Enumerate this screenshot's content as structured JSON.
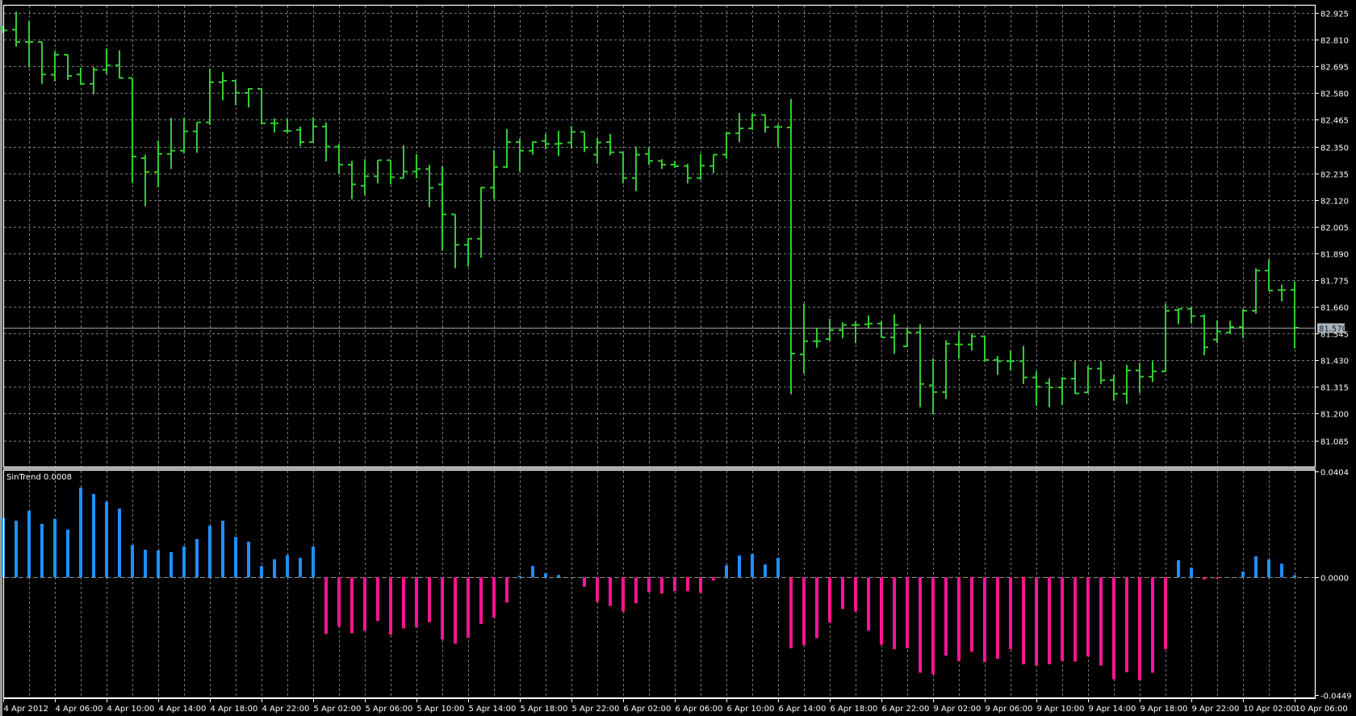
{
  "colors": {
    "background": "#000000",
    "bars": "#33cc33",
    "hist_up": "#1e90ff",
    "hist_down": "#ff1493",
    "grid": "#7a7a7a",
    "axis": "#ffffff",
    "price_line": "#a0a0a0",
    "price_label_bg": "#a9b4bd"
  },
  "chart_data": [
    {
      "type": "ohlc",
      "title": "",
      "ylim": [
        81.085,
        82.925
      ],
      "y_ticks": [
        "82.925",
        "82.810",
        "82.695",
        "82.580",
        "82.465",
        "82.350",
        "82.235",
        "82.120",
        "82.005",
        "81.890",
        "81.775",
        "81.660",
        "81.545",
        "81.430",
        "81.315",
        "81.200",
        "81.085"
      ],
      "current_price": "81.570",
      "grid": true,
      "bar_interval": "1 hour",
      "ohlc": [
        [
          82.86,
          82.87,
          82.84,
          82.85
        ],
        [
          82.853,
          82.93,
          82.78,
          82.8
        ],
        [
          82.8,
          82.89,
          82.69,
          82.8
        ],
        [
          82.8,
          82.8,
          82.62,
          82.66
        ],
        [
          82.659,
          82.76,
          82.63,
          82.745
        ],
        [
          82.745,
          82.745,
          82.636,
          82.654
        ],
        [
          82.66,
          82.69,
          82.616,
          82.62
        ],
        [
          82.62,
          82.693,
          82.575,
          82.68
        ],
        [
          82.68,
          82.772,
          82.662,
          82.7
        ],
        [
          82.7,
          82.764,
          82.643,
          82.645
        ],
        [
          82.645,
          82.645,
          82.193,
          82.307
        ],
        [
          82.3,
          82.315,
          82.092,
          82.24
        ],
        [
          82.24,
          82.376,
          82.174,
          82.318
        ],
        [
          82.318,
          82.473,
          82.253,
          82.332
        ],
        [
          82.332,
          82.473,
          82.32,
          82.415
        ],
        [
          82.415,
          82.454,
          82.323,
          82.454
        ],
        [
          82.454,
          82.685,
          82.442,
          82.627
        ],
        [
          82.627,
          82.67,
          82.549,
          82.633
        ],
        [
          82.633,
          82.633,
          82.527,
          82.581
        ],
        [
          82.581,
          82.602,
          82.518,
          82.598
        ],
        [
          82.598,
          82.598,
          82.445,
          82.45
        ],
        [
          82.45,
          82.471,
          82.41,
          82.45
        ],
        [
          82.417,
          82.469,
          82.407,
          82.417
        ],
        [
          82.422,
          82.436,
          82.352,
          82.369
        ],
        [
          82.369,
          82.474,
          82.367,
          82.436
        ],
        [
          82.436,
          82.454,
          82.286,
          82.35
        ],
        [
          82.349,
          82.361,
          82.233,
          82.272
        ],
        [
          82.272,
          82.288,
          82.123,
          82.187
        ],
        [
          82.181,
          82.295,
          82.141,
          82.222
        ],
        [
          82.222,
          82.291,
          82.191,
          82.291
        ],
        [
          82.291,
          82.291,
          82.187,
          82.218
        ],
        [
          82.214,
          82.355,
          82.214,
          82.242
        ],
        [
          82.242,
          82.317,
          82.213,
          82.253
        ],
        [
          82.253,
          82.271,
          82.089,
          82.172
        ],
        [
          82.187,
          82.265,
          81.901,
          82.058
        ],
        [
          82.058,
          82.058,
          81.826,
          81.927
        ],
        [
          81.927,
          81.956,
          81.834,
          81.953
        ],
        [
          81.953,
          82.176,
          81.871,
          82.173
        ],
        [
          82.173,
          82.334,
          82.123,
          82.262
        ],
        [
          82.262,
          82.425,
          82.257,
          82.369
        ],
        [
          82.369,
          82.384,
          82.242,
          82.332
        ],
        [
          82.332,
          82.371,
          82.315,
          82.369
        ],
        [
          82.374,
          82.404,
          82.338,
          82.361
        ],
        [
          82.361,
          82.418,
          82.309,
          82.363
        ],
        [
          82.367,
          82.438,
          82.341,
          82.413
        ],
        [
          82.413,
          82.413,
          82.326,
          82.346
        ],
        [
          82.315,
          82.386,
          82.276,
          82.367
        ],
        [
          82.369,
          82.404,
          82.312,
          82.325
        ],
        [
          82.325,
          82.325,
          82.191,
          82.214
        ],
        [
          82.214,
          82.35,
          82.158,
          82.315
        ],
        [
          82.318,
          82.344,
          82.271,
          82.288
        ],
        [
          82.288,
          82.295,
          82.253,
          82.272
        ],
        [
          82.272,
          82.288,
          82.257,
          82.265
        ],
        [
          82.266,
          82.276,
          82.191,
          82.214
        ],
        [
          82.214,
          82.317,
          82.207,
          82.268
        ],
        [
          82.266,
          82.315,
          82.236,
          82.315
        ],
        [
          82.315,
          82.413,
          82.297,
          82.407
        ],
        [
          82.407,
          82.494,
          82.369,
          82.428
        ],
        [
          82.428,
          82.492,
          82.421,
          82.485
        ],
        [
          82.486,
          82.486,
          82.41,
          82.433
        ],
        [
          82.434,
          82.445,
          82.346,
          82.434
        ],
        [
          82.432,
          82.555,
          81.284,
          81.459
        ],
        [
          81.455,
          81.674,
          81.373,
          81.512
        ],
        [
          81.512,
          81.57,
          81.484,
          81.512
        ],
        [
          81.521,
          81.608,
          81.512,
          81.56
        ],
        [
          81.56,
          81.593,
          81.524,
          81.582
        ],
        [
          81.582,
          81.597,
          81.504,
          81.582
        ],
        [
          81.585,
          81.623,
          81.565,
          81.588
        ],
        [
          81.588,
          81.599,
          81.527,
          81.529
        ],
        [
          81.529,
          81.628,
          81.458,
          81.582
        ],
        [
          81.49,
          81.57,
          81.487,
          81.55
        ],
        [
          81.55,
          81.585,
          81.228,
          81.328
        ],
        [
          81.322,
          81.438,
          81.197,
          81.293
        ],
        [
          81.293,
          81.516,
          81.263,
          81.501
        ],
        [
          81.498,
          81.554,
          81.437,
          81.498
        ],
        [
          81.498,
          81.545,
          81.472,
          81.533
        ],
        [
          81.533,
          81.533,
          81.423,
          81.431
        ],
        [
          81.431,
          81.448,
          81.367,
          81.426
        ],
        [
          81.426,
          81.473,
          81.386,
          81.426
        ],
        [
          81.426,
          81.492,
          81.328,
          81.356
        ],
        [
          81.356,
          81.382,
          81.234,
          81.316
        ],
        [
          81.332,
          81.353,
          81.228,
          81.313
        ],
        [
          81.313,
          81.357,
          81.237,
          81.351
        ],
        [
          81.351,
          81.426,
          81.284,
          81.287
        ],
        [
          81.292,
          81.405,
          81.287,
          81.394
        ],
        [
          81.394,
          81.426,
          81.328,
          81.344
        ],
        [
          81.344,
          81.367,
          81.255,
          81.286
        ],
        [
          81.286,
          81.411,
          81.241,
          81.386
        ],
        [
          81.386,
          81.419,
          81.29,
          81.359
        ],
        [
          81.359,
          81.426,
          81.336,
          81.382
        ],
        [
          81.382,
          81.674,
          81.38,
          81.643
        ],
        [
          81.646,
          81.652,
          81.585,
          81.651
        ],
        [
          81.651,
          81.66,
          81.588,
          81.62
        ],
        [
          81.62,
          81.628,
          81.452,
          81.486
        ],
        [
          81.519,
          81.602,
          81.504,
          81.554
        ],
        [
          81.55,
          81.6,
          81.544,
          81.573
        ],
        [
          81.573,
          81.652,
          81.525,
          81.643
        ],
        [
          81.643,
          81.826,
          81.631,
          81.816
        ],
        [
          81.816,
          81.863,
          81.73,
          81.73
        ],
        [
          81.732,
          81.756,
          81.683,
          81.732
        ],
        [
          81.733,
          81.77,
          81.481,
          81.57
        ]
      ],
      "x_labels": [
        "4 Apr 2012",
        "4 Apr 06:00",
        "4 Apr 10:00",
        "4 Apr 14:00",
        "4 Apr 18:00",
        "4 Apr 22:00",
        "5 Apr 02:00",
        "5 Apr 06:00",
        "5 Apr 10:00",
        "5 Apr 14:00",
        "5 Apr 18:00",
        "5 Apr 22:00",
        "6 Apr 02:00",
        "6 Apr 06:00",
        "6 Apr 10:00",
        "6 Apr 14:00",
        "6 Apr 18:00",
        "6 Apr 22:00",
        "9 Apr 02:00",
        "9 Apr 06:00",
        "9 Apr 10:00",
        "9 Apr 14:00",
        "9 Apr 18:00",
        "9 Apr 22:00",
        "10 Apr 02:00",
        "10 Apr 06:00"
      ]
    },
    {
      "type": "bar",
      "title": "SinTrend 0.0008",
      "ylim": [
        -0.0449,
        0.0404
      ],
      "y_ticks": [
        "0.0404",
        "0.0000",
        "-0.0449"
      ],
      "values": [
        0.0226,
        0.0216,
        0.0254,
        0.0204,
        0.0223,
        0.0182,
        0.0342,
        0.0318,
        0.0288,
        0.0262,
        0.0123,
        0.0105,
        0.0103,
        0.0096,
        0.0118,
        0.0146,
        0.0197,
        0.0216,
        0.0154,
        0.0136,
        0.0043,
        0.0069,
        0.0084,
        0.0074,
        0.0118,
        -0.0216,
        -0.0188,
        -0.0213,
        -0.0204,
        -0.0167,
        -0.0219,
        -0.0195,
        -0.0191,
        -0.0171,
        -0.0238,
        -0.0253,
        -0.0231,
        -0.0178,
        -0.0154,
        -0.0096,
        0.0006,
        0.0043,
        0.0015,
        0.0009,
        0.0,
        -0.0036,
        -0.0093,
        -0.0109,
        -0.013,
        -0.0099,
        -0.0056,
        -0.0062,
        -0.0053,
        -0.0053,
        -0.0059,
        -0.0012,
        0.0046,
        0.0083,
        0.0089,
        0.0049,
        0.0074,
        -0.0271,
        -0.0259,
        -0.0232,
        -0.0173,
        -0.0121,
        -0.013,
        -0.0204,
        -0.0257,
        -0.0274,
        -0.0271,
        -0.0364,
        -0.037,
        -0.0299,
        -0.0319,
        -0.0284,
        -0.0324,
        -0.0311,
        -0.0274,
        -0.0332,
        -0.0336,
        -0.0332,
        -0.0319,
        -0.0321,
        -0.0302,
        -0.0337,
        -0.0389,
        -0.0362,
        -0.0392,
        -0.0364,
        -0.0274,
        0.0065,
        0.0037,
        -0.0008,
        -0.0002,
        0.0,
        0.0022,
        0.008,
        0.0068,
        0.0052,
        0.0008
      ]
    }
  ]
}
